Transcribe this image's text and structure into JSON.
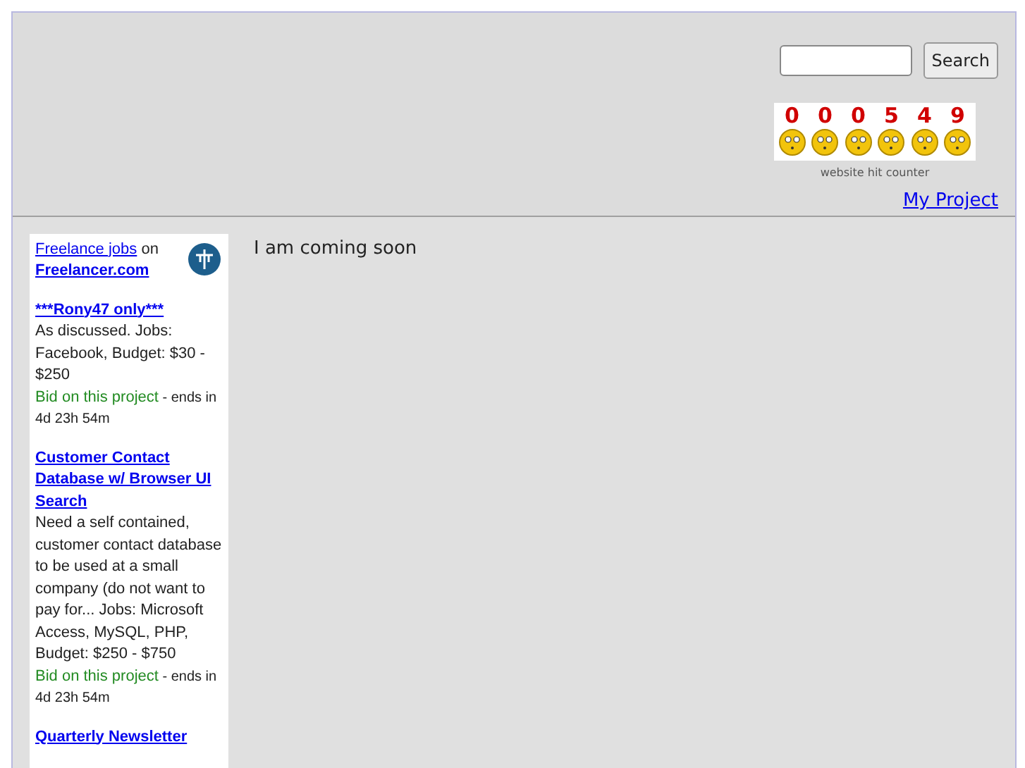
{
  "search": {
    "button": "Search"
  },
  "counter": {
    "digits": [
      "0",
      "0",
      "0",
      "5",
      "4",
      "9"
    ],
    "caption": "website hit counter"
  },
  "header_link": "My Project",
  "sidebar": {
    "intro": {
      "link": "Freelance jobs",
      "text": "on",
      "site": "Freelancer.com"
    },
    "projects": [
      {
        "title": "***Rony47 only***",
        "description": "As discussed. Jobs: Facebook, Budget: $30 - $250",
        "bid": "Bid on this project",
        "ends": "- ends in 4d 23h 54m"
      },
      {
        "title": "Customer Contact Database w/ Browser UI Search",
        "description": "Need a self contained, customer contact database to be used at a small company (do not want to pay for... Jobs: Microsoft Access, MySQL, PHP, Budget: $250 - $750",
        "bid": "Bid on this project",
        "ends": "- ends in 4d 23h 54m"
      },
      {
        "title": "Quarterly Newsletter"
      }
    ]
  },
  "main_text": "I am coming soon"
}
